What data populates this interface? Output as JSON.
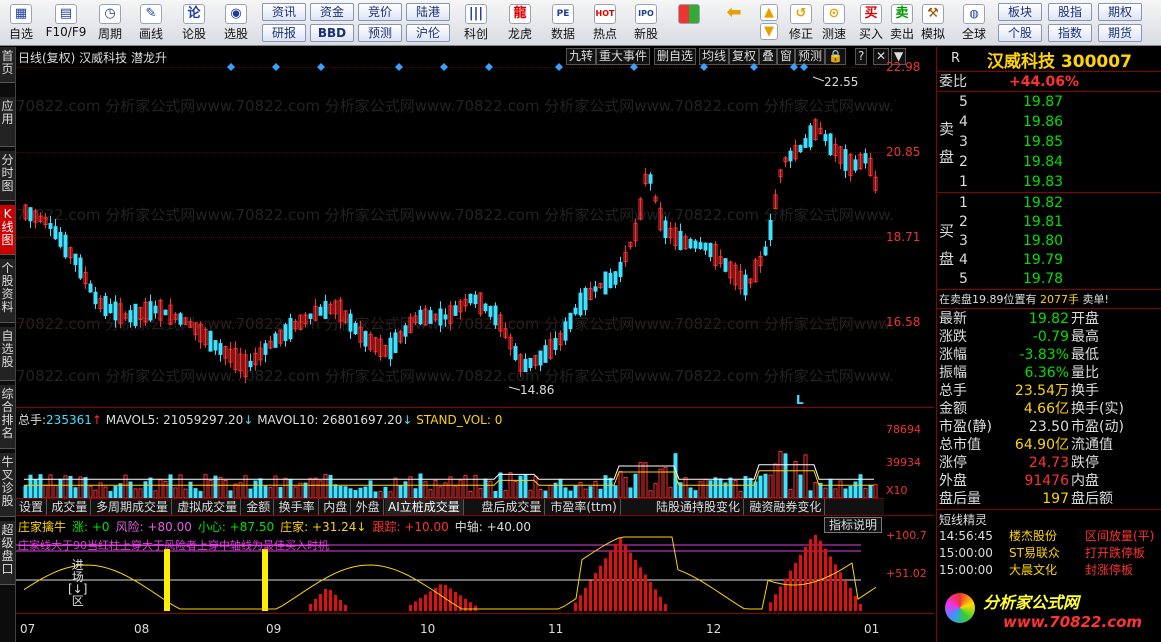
{
  "toolbar": {
    "items": [
      {
        "label": "自选",
        "icon": "▦"
      },
      {
        "label": "F10/F9",
        "icon": "▤"
      },
      {
        "label": "周期",
        "icon": "◷"
      },
      {
        "label": "画线",
        "icon": "✎"
      },
      {
        "label": "论股",
        "icon": "论"
      },
      {
        "label": "选股",
        "icon": "◉"
      }
    ],
    "grid_top": [
      "资讯",
      "资金",
      "竞价",
      "陆港"
    ],
    "grid_bottom": [
      "研报",
      "BBD",
      "预测",
      "沪伦"
    ],
    "items2": [
      {
        "label": "科创",
        "icon": "|||"
      },
      {
        "label": "龙虎",
        "icon": "龍"
      },
      {
        "label": "数据",
        "icon": "PE"
      },
      {
        "label": "热点",
        "icon": "HOT"
      },
      {
        "label": "新股",
        "icon": "IPO"
      }
    ],
    "items3": [
      {
        "label": "修正",
        "icon": "↺"
      },
      {
        "label": "测速",
        "icon": "⊙"
      },
      {
        "label": "买入",
        "icon": "买"
      },
      {
        "label": "卖出",
        "icon": "卖"
      },
      {
        "label": "模拟",
        "icon": "⚒"
      },
      {
        "label": "全球",
        "icon": "🌐"
      }
    ],
    "grid2_top": [
      "板块",
      "股指",
      "期权"
    ],
    "grid2_bottom": [
      "个股",
      "指数",
      "期货"
    ]
  },
  "leftnav": [
    "首页",
    "应用",
    "分时图",
    "K线图",
    "个股资料",
    "自选股",
    "综合排名",
    "牛叉诊股",
    "超级盘口"
  ],
  "chart": {
    "title": "日线(复权)  汉威科技  潜龙升",
    "top_buttons": [
      "九转",
      "重大事件",
      "删自选",
      "均线",
      "复权",
      "叠",
      "窗",
      "预测",
      "🔒",
      "?",
      "✕",
      "▼"
    ],
    "price_axis": [
      "22.98",
      "20.85",
      "18.71",
      "16.58"
    ],
    "high_label": "22.55",
    "low_label": "14.86",
    "marker": "L",
    "watermark": "70822.com 分析家公式网www.70822.com 分析家公式网www.70822.com 分析家公式网www.70822.com 分析家公式网www.70822.com",
    "vol_info": {
      "label": "总手:",
      "value": "235361",
      "ma5": "MAVOL5: 21059297.20",
      "ma10": "MAVOL10: 26801697.20",
      "stand": "STAND_VOL: 0"
    },
    "vol_axis": [
      "78694",
      "39934",
      "X10"
    ],
    "sub_tabs": [
      "设置",
      "成交量",
      "多周期成交量",
      "虚拟成交量",
      "金额",
      "换手率",
      "内盘",
      "外盘",
      "AI立桩成交量",
      "盘后成交量",
      "市盈率(ttm)",
      "陆股通持股变化",
      "融资融券变化"
    ],
    "ind_info": [
      {
        "t": "庄家擒牛",
        "c": "y"
      },
      {
        "t": "涨: +0",
        "c": "g"
      },
      {
        "t": "风险: +80.00",
        "c": "m"
      },
      {
        "t": "小心: +87.50",
        "c": "g"
      },
      {
        "t": "庄家: +31.24↓",
        "c": "y"
      },
      {
        "t": "跟踪: +10.00",
        "c": "r"
      },
      {
        "t": "中轴: +40.00",
        "c": "w"
      }
    ],
    "ind_btn": "指标说明",
    "ind_axis": [
      "+100.7",
      "+51.02"
    ],
    "ind_note": "庄家线大于90当红柱上穿大于风险者上穿中轴线为最佳买入时机",
    "ind_labels": [
      "进",
      "场",
      "[↓]",
      "区"
    ],
    "date_axis": [
      "07",
      "08",
      "09",
      "10",
      "11",
      "12",
      "01"
    ]
  },
  "right": {
    "flag": "R",
    "name": "汉威科技",
    "code": "300007",
    "wb_label": "委比",
    "wb": "+44.06%",
    "sell_label": "卖盘",
    "sells": [
      {
        "n": "5",
        "p": "19.87"
      },
      {
        "n": "4",
        "p": "19.86"
      },
      {
        "n": "3",
        "p": "19.85"
      },
      {
        "n": "2",
        "p": "19.84"
      },
      {
        "n": "1",
        "p": "19.83"
      }
    ],
    "buy_label": "买盘",
    "buys": [
      {
        "n": "1",
        "p": "19.82"
      },
      {
        "n": "2",
        "p": "19.81"
      },
      {
        "n": "3",
        "p": "19.80"
      },
      {
        "n": "4",
        "p": "19.79"
      },
      {
        "n": "5",
        "p": "19.78"
      }
    ],
    "notice": "在卖盘19.89位置有",
    "notice_val": "2077手",
    "notice_act": "卖单!",
    "stats": [
      {
        "k": "最新",
        "v": "19.82",
        "c": "g",
        "k2": "开盘"
      },
      {
        "k": "涨跌",
        "v": "-0.79",
        "c": "g",
        "k2": "最高"
      },
      {
        "k": "涨幅",
        "v": "-3.83%",
        "c": "g",
        "k2": "最低"
      },
      {
        "k": "振幅",
        "v": "6.36%",
        "c": "g",
        "k2": "量比"
      },
      {
        "k": "总手",
        "v": "23.54万",
        "c": "y",
        "k2": "换手"
      },
      {
        "k": "金额",
        "v": "4.66亿",
        "c": "y",
        "k2": "换手(实)"
      },
      {
        "k": "市盈(静)",
        "v": "23.50",
        "c": "w",
        "k2": "市盈(动)"
      },
      {
        "k": "总市值",
        "v": "64.90亿",
        "c": "y",
        "k2": "流通值"
      },
      {
        "k": "涨停",
        "v": "24.73",
        "c": "r",
        "k2": "跌停"
      },
      {
        "k": "外盘",
        "v": "91476",
        "c": "r",
        "k2": "内盘"
      },
      {
        "k": "盘后量",
        "v": "197",
        "c": "y",
        "k2": "盘后额"
      }
    ],
    "news_title": "短线精灵",
    "news": [
      {
        "time": "14:56:45",
        "name": "楼杰股份",
        "event": "区间放量(平)"
      },
      {
        "time": "15:00:00",
        "name": "ST易联众",
        "event": "打开跌停板"
      },
      {
        "time": "15:00:00",
        "name": "大晨文化",
        "event": "封涨停板"
      }
    ],
    "logo": "分析家公式网",
    "logo_url": "www.70822.com"
  }
}
